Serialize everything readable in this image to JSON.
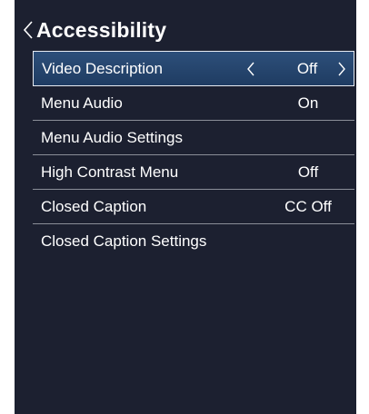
{
  "header": {
    "title": "Accessibility",
    "back_icon": "chevron-left-icon"
  },
  "menu": {
    "items": [
      {
        "label": "Video Description",
        "value": "Off",
        "selected": true
      },
      {
        "label": "Menu Audio",
        "value": "On"
      },
      {
        "label": "Menu Audio Settings",
        "value": ""
      },
      {
        "label": "High Contrast Menu",
        "value": "Off"
      },
      {
        "label": "Closed Caption",
        "value": "CC Off"
      },
      {
        "label": "Closed Caption Settings",
        "value": ""
      }
    ],
    "selector_icons": [
      "chevron-left-icon",
      "chevron-right-icon"
    ]
  },
  "colors": {
    "background": "#1c2030",
    "selected_fill": "#2d4f7a",
    "selected_border": "#e8ecf2",
    "divider": "#8a8e98",
    "text": "#ffffff"
  }
}
